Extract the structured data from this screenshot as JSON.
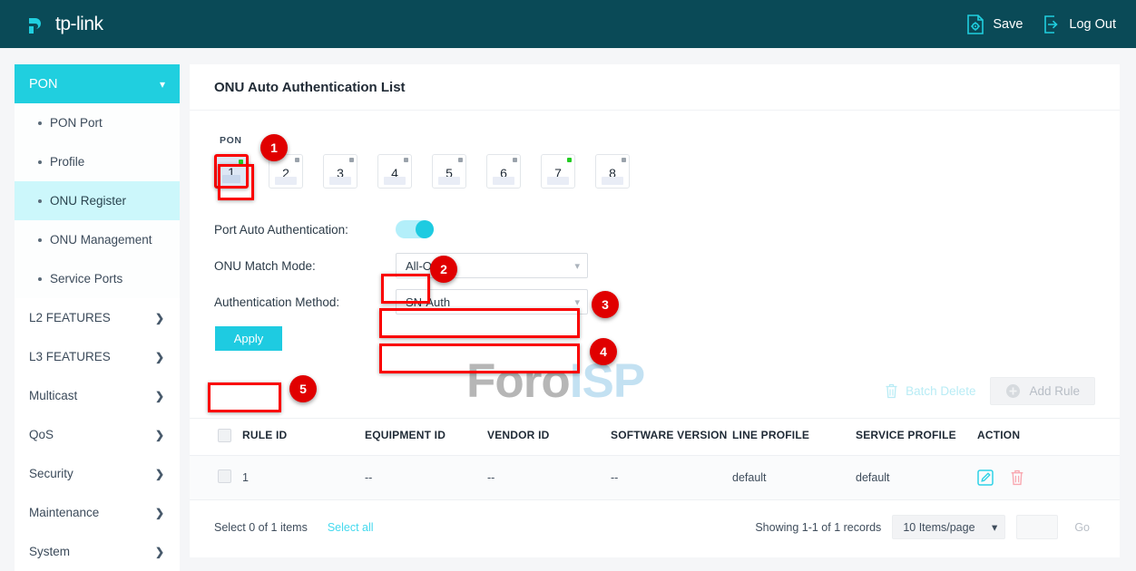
{
  "topbar": {
    "brand": "tp-link",
    "save_label": "Save",
    "logout_label": "Log Out",
    "save_icon": "save-gear-document-icon",
    "logout_icon": "logout-arrow-icon",
    "background": "#0a4a57",
    "accent": "#20cfdf"
  },
  "sidebar": {
    "group": {
      "label": "PON",
      "icon": "chevron-down-icon",
      "expanded": true
    },
    "subitems": [
      {
        "label": "PON Port",
        "active": false
      },
      {
        "label": "Profile",
        "active": false
      },
      {
        "label": "ONU Register",
        "active": true
      },
      {
        "label": "ONU Management",
        "active": false
      },
      {
        "label": "Service Ports",
        "active": false
      }
    ],
    "items": [
      {
        "label": "L2 FEATURES",
        "icon": "chevron-right-icon"
      },
      {
        "label": "L3 FEATURES",
        "icon": "chevron-right-icon"
      },
      {
        "label": "Multicast",
        "icon": "chevron-right-icon"
      },
      {
        "label": "QoS",
        "icon": "chevron-right-icon"
      },
      {
        "label": "Security",
        "icon": "chevron-right-icon"
      },
      {
        "label": "Maintenance",
        "icon": "chevron-right-icon"
      },
      {
        "label": "System",
        "icon": "chevron-right-icon"
      }
    ]
  },
  "watermark": {
    "part1": "Foro",
    "part2": "ISP"
  },
  "card": {
    "title": "ONU Auto Authentication List",
    "pon_label": "PON",
    "ports": [
      {
        "num": "1",
        "status": "up",
        "selected": true
      },
      {
        "num": "2",
        "status": "down",
        "selected": false
      },
      {
        "num": "3",
        "status": "down",
        "selected": false
      },
      {
        "num": "4",
        "status": "down",
        "selected": false
      },
      {
        "num": "5",
        "status": "down",
        "selected": false
      },
      {
        "num": "6",
        "status": "down",
        "selected": false
      },
      {
        "num": "7",
        "status": "up",
        "selected": false
      },
      {
        "num": "8",
        "status": "down",
        "selected": false
      }
    ],
    "form": {
      "auto_auth_label": "Port Auto Authentication:",
      "auto_auth_state": "on",
      "match_mode_label": "ONU Match Mode:",
      "match_mode_value": "All-ONU",
      "auth_method_label": "Authentication Method:",
      "auth_method_value": "SN-Auth",
      "apply_label": "Apply"
    }
  },
  "annotations": [
    {
      "number": "1",
      "target": "pon-port-1"
    },
    {
      "number": "2",
      "target": "port-auto-authentication-toggle"
    },
    {
      "number": "3",
      "target": "onu-match-mode-select"
    },
    {
      "number": "4",
      "target": "authentication-method-select"
    },
    {
      "number": "5",
      "target": "apply-button"
    }
  ],
  "toolbar": {
    "batch_delete_label": "Batch Delete",
    "batch_delete_icon": "trash-icon",
    "add_rule_label": "Add Rule",
    "add_rule_icon": "plus-circle-icon"
  },
  "table": {
    "columns": [
      "RULE ID",
      "EQUIPMENT ID",
      "VENDOR ID",
      "SOFTWARE VERSION",
      "LINE PROFILE",
      "SERVICE PROFILE",
      "ACTION"
    ],
    "rows": [
      {
        "rule_id": "1",
        "equipment_id": "--",
        "vendor_id": "--",
        "software_version": "--",
        "line_profile": "default",
        "service_profile": "default",
        "edit_icon": "edit-pencil-icon",
        "delete_icon": "trash-icon"
      }
    ]
  },
  "footer": {
    "select_count": "Select 0 of 1 items",
    "select_all": "Select all",
    "showing": "Showing 1-1 of 1 records",
    "page_size": "10 Items/page",
    "page_input_value": "",
    "go_label": "Go"
  }
}
